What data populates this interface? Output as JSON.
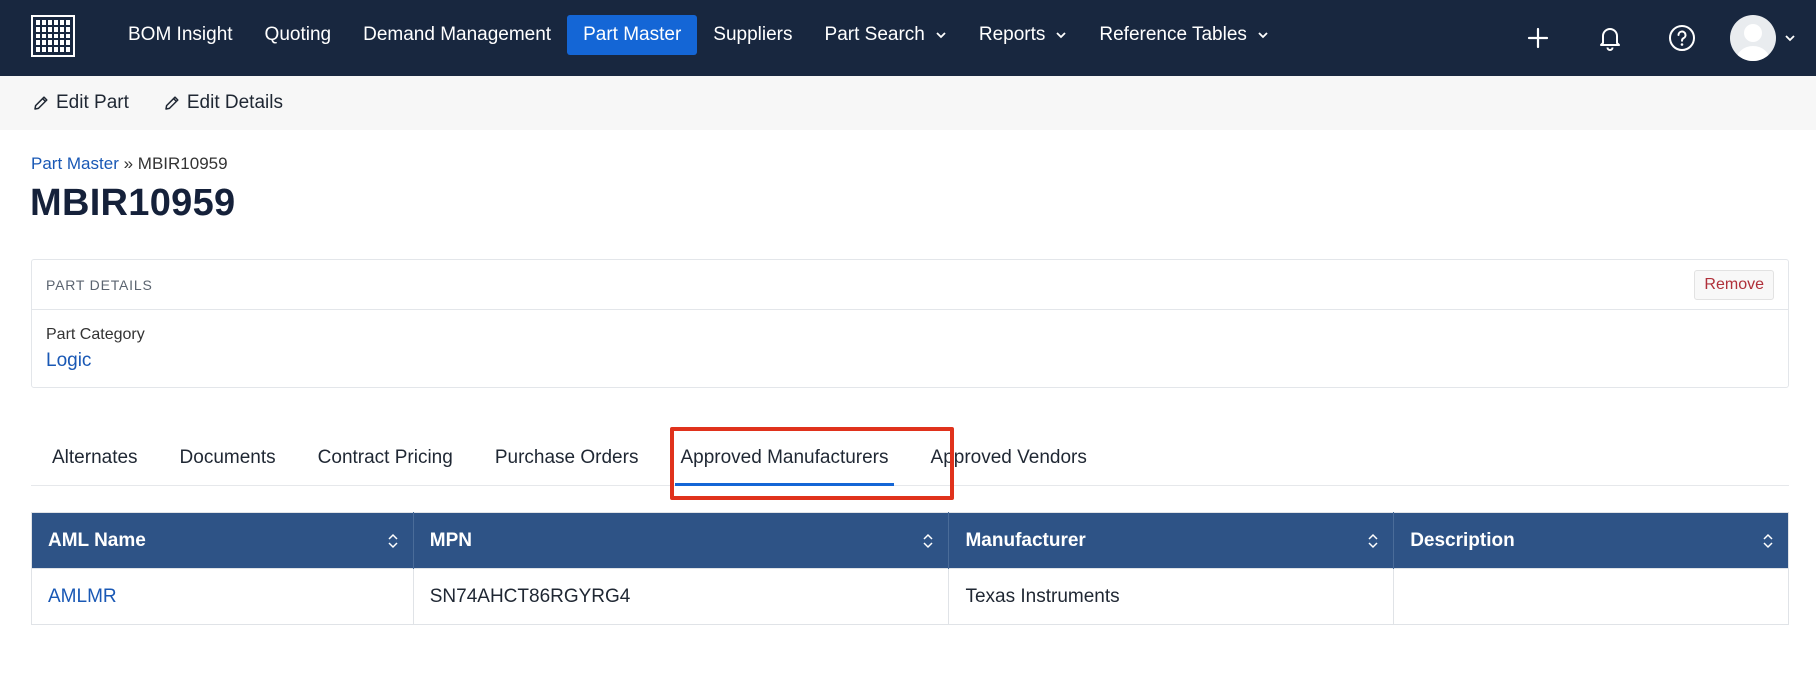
{
  "nav": {
    "items": [
      {
        "label": "BOM Insight",
        "dropdown": false,
        "active": false
      },
      {
        "label": "Quoting",
        "dropdown": false,
        "active": false
      },
      {
        "label": "Demand Management",
        "dropdown": false,
        "active": false
      },
      {
        "label": "Part Master",
        "dropdown": false,
        "active": true
      },
      {
        "label": "Suppliers",
        "dropdown": false,
        "active": false
      },
      {
        "label": "Part Search",
        "dropdown": true,
        "active": false
      },
      {
        "label": "Reports",
        "dropdown": true,
        "active": false
      },
      {
        "label": "Reference Tables",
        "dropdown": true,
        "active": false
      }
    ],
    "right_icons": [
      "plus-icon",
      "bell-icon",
      "help-icon",
      "avatar",
      "chevron-down-icon"
    ],
    "colors": {
      "bar": "#18273f",
      "active": "#1466d6"
    }
  },
  "actions": {
    "edit_part": "Edit Part",
    "edit_details": "Edit Details"
  },
  "breadcrumb": {
    "parent": "Part Master",
    "separator": "»",
    "current": "MBIR10959"
  },
  "page_title": "MBIR10959",
  "part_details": {
    "title": "PART DETAILS",
    "remove_label": "Remove",
    "field_label": "Part Category",
    "field_value": "Logic"
  },
  "tabs": [
    {
      "label": "Alternates",
      "active": false
    },
    {
      "label": "Documents",
      "active": false
    },
    {
      "label": "Contract Pricing",
      "active": false
    },
    {
      "label": "Purchase Orders",
      "active": false
    },
    {
      "label": "Approved Manufacturers",
      "active": true
    },
    {
      "label": "Approved Vendors",
      "active": false
    }
  ],
  "table": {
    "header_color": "#2e5386",
    "columns": [
      "AML Name",
      "MPN",
      "Manufacturer",
      "Description"
    ],
    "rows": [
      {
        "aml_name": "AMLMR",
        "mpn": "SN74AHCT86RGYRG4",
        "manufacturer": "Texas Instruments",
        "description": ""
      }
    ]
  },
  "highlight_color": "#e0321c"
}
